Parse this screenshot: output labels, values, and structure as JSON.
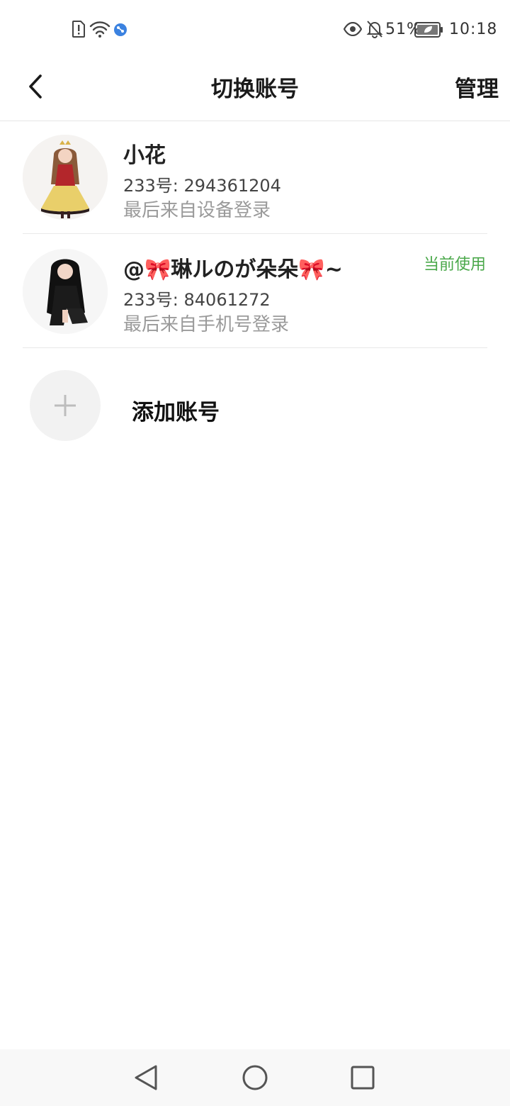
{
  "status_bar": {
    "battery_percent": "51%",
    "time": "10:18",
    "icons": [
      "sim-alert-icon",
      "wifi-icon",
      "network-app-icon",
      "eye-icon",
      "bell-off-icon",
      "battery-icon"
    ]
  },
  "header": {
    "title": "切换账号",
    "manage_label": "管理",
    "back_icon": "chevron-left-icon"
  },
  "accounts": [
    {
      "name": "小花",
      "id_text": "233号: 294361204",
      "login_text": "最后来自设备登录",
      "current": false
    },
    {
      "name": "@🎀琳ルのが朵朵🎀~",
      "id_text": "233号: 84061272",
      "login_text": "最后来自手机号登录",
      "current": true,
      "current_label": "当前使用"
    }
  ],
  "add_account": {
    "label": "添加账号",
    "icon": "plus-icon"
  },
  "nav_bar": {
    "icons": [
      "nav-back-icon",
      "nav-home-icon",
      "nav-recents-icon"
    ]
  },
  "colors": {
    "accent_green": "#4aa84a",
    "divider": "#e9e9e9",
    "secondary_text": "#9a9a9a",
    "background": "#ffffff"
  }
}
